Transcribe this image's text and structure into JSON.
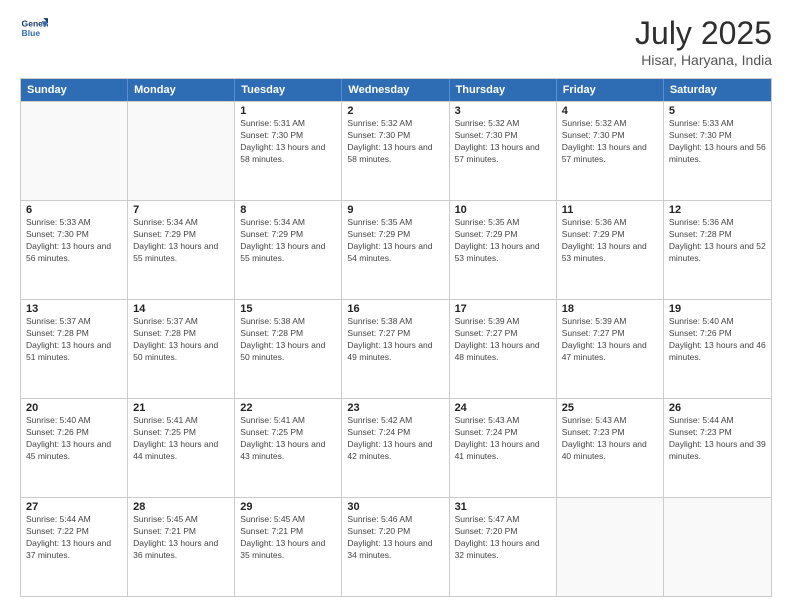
{
  "header": {
    "logo_line1": "General",
    "logo_line2": "Blue",
    "month": "July 2025",
    "location": "Hisar, Haryana, India"
  },
  "weekdays": [
    "Sunday",
    "Monday",
    "Tuesday",
    "Wednesday",
    "Thursday",
    "Friday",
    "Saturday"
  ],
  "rows": [
    [
      {
        "day": "",
        "info": ""
      },
      {
        "day": "",
        "info": ""
      },
      {
        "day": "1",
        "info": "Sunrise: 5:31 AM\nSunset: 7:30 PM\nDaylight: 13 hours and 58 minutes."
      },
      {
        "day": "2",
        "info": "Sunrise: 5:32 AM\nSunset: 7:30 PM\nDaylight: 13 hours and 58 minutes."
      },
      {
        "day": "3",
        "info": "Sunrise: 5:32 AM\nSunset: 7:30 PM\nDaylight: 13 hours and 57 minutes."
      },
      {
        "day": "4",
        "info": "Sunrise: 5:32 AM\nSunset: 7:30 PM\nDaylight: 13 hours and 57 minutes."
      },
      {
        "day": "5",
        "info": "Sunrise: 5:33 AM\nSunset: 7:30 PM\nDaylight: 13 hours and 56 minutes."
      }
    ],
    [
      {
        "day": "6",
        "info": "Sunrise: 5:33 AM\nSunset: 7:30 PM\nDaylight: 13 hours and 56 minutes."
      },
      {
        "day": "7",
        "info": "Sunrise: 5:34 AM\nSunset: 7:29 PM\nDaylight: 13 hours and 55 minutes."
      },
      {
        "day": "8",
        "info": "Sunrise: 5:34 AM\nSunset: 7:29 PM\nDaylight: 13 hours and 55 minutes."
      },
      {
        "day": "9",
        "info": "Sunrise: 5:35 AM\nSunset: 7:29 PM\nDaylight: 13 hours and 54 minutes."
      },
      {
        "day": "10",
        "info": "Sunrise: 5:35 AM\nSunset: 7:29 PM\nDaylight: 13 hours and 53 minutes."
      },
      {
        "day": "11",
        "info": "Sunrise: 5:36 AM\nSunset: 7:29 PM\nDaylight: 13 hours and 53 minutes."
      },
      {
        "day": "12",
        "info": "Sunrise: 5:36 AM\nSunset: 7:28 PM\nDaylight: 13 hours and 52 minutes."
      }
    ],
    [
      {
        "day": "13",
        "info": "Sunrise: 5:37 AM\nSunset: 7:28 PM\nDaylight: 13 hours and 51 minutes."
      },
      {
        "day": "14",
        "info": "Sunrise: 5:37 AM\nSunset: 7:28 PM\nDaylight: 13 hours and 50 minutes."
      },
      {
        "day": "15",
        "info": "Sunrise: 5:38 AM\nSunset: 7:28 PM\nDaylight: 13 hours and 50 minutes."
      },
      {
        "day": "16",
        "info": "Sunrise: 5:38 AM\nSunset: 7:27 PM\nDaylight: 13 hours and 49 minutes."
      },
      {
        "day": "17",
        "info": "Sunrise: 5:39 AM\nSunset: 7:27 PM\nDaylight: 13 hours and 48 minutes."
      },
      {
        "day": "18",
        "info": "Sunrise: 5:39 AM\nSunset: 7:27 PM\nDaylight: 13 hours and 47 minutes."
      },
      {
        "day": "19",
        "info": "Sunrise: 5:40 AM\nSunset: 7:26 PM\nDaylight: 13 hours and 46 minutes."
      }
    ],
    [
      {
        "day": "20",
        "info": "Sunrise: 5:40 AM\nSunset: 7:26 PM\nDaylight: 13 hours and 45 minutes."
      },
      {
        "day": "21",
        "info": "Sunrise: 5:41 AM\nSunset: 7:25 PM\nDaylight: 13 hours and 44 minutes."
      },
      {
        "day": "22",
        "info": "Sunrise: 5:41 AM\nSunset: 7:25 PM\nDaylight: 13 hours and 43 minutes."
      },
      {
        "day": "23",
        "info": "Sunrise: 5:42 AM\nSunset: 7:24 PM\nDaylight: 13 hours and 42 minutes."
      },
      {
        "day": "24",
        "info": "Sunrise: 5:43 AM\nSunset: 7:24 PM\nDaylight: 13 hours and 41 minutes."
      },
      {
        "day": "25",
        "info": "Sunrise: 5:43 AM\nSunset: 7:23 PM\nDaylight: 13 hours and 40 minutes."
      },
      {
        "day": "26",
        "info": "Sunrise: 5:44 AM\nSunset: 7:23 PM\nDaylight: 13 hours and 39 minutes."
      }
    ],
    [
      {
        "day": "27",
        "info": "Sunrise: 5:44 AM\nSunset: 7:22 PM\nDaylight: 13 hours and 37 minutes."
      },
      {
        "day": "28",
        "info": "Sunrise: 5:45 AM\nSunset: 7:21 PM\nDaylight: 13 hours and 36 minutes."
      },
      {
        "day": "29",
        "info": "Sunrise: 5:45 AM\nSunset: 7:21 PM\nDaylight: 13 hours and 35 minutes."
      },
      {
        "day": "30",
        "info": "Sunrise: 5:46 AM\nSunset: 7:20 PM\nDaylight: 13 hours and 34 minutes."
      },
      {
        "day": "31",
        "info": "Sunrise: 5:47 AM\nSunset: 7:20 PM\nDaylight: 13 hours and 32 minutes."
      },
      {
        "day": "",
        "info": ""
      },
      {
        "day": "",
        "info": ""
      }
    ]
  ]
}
